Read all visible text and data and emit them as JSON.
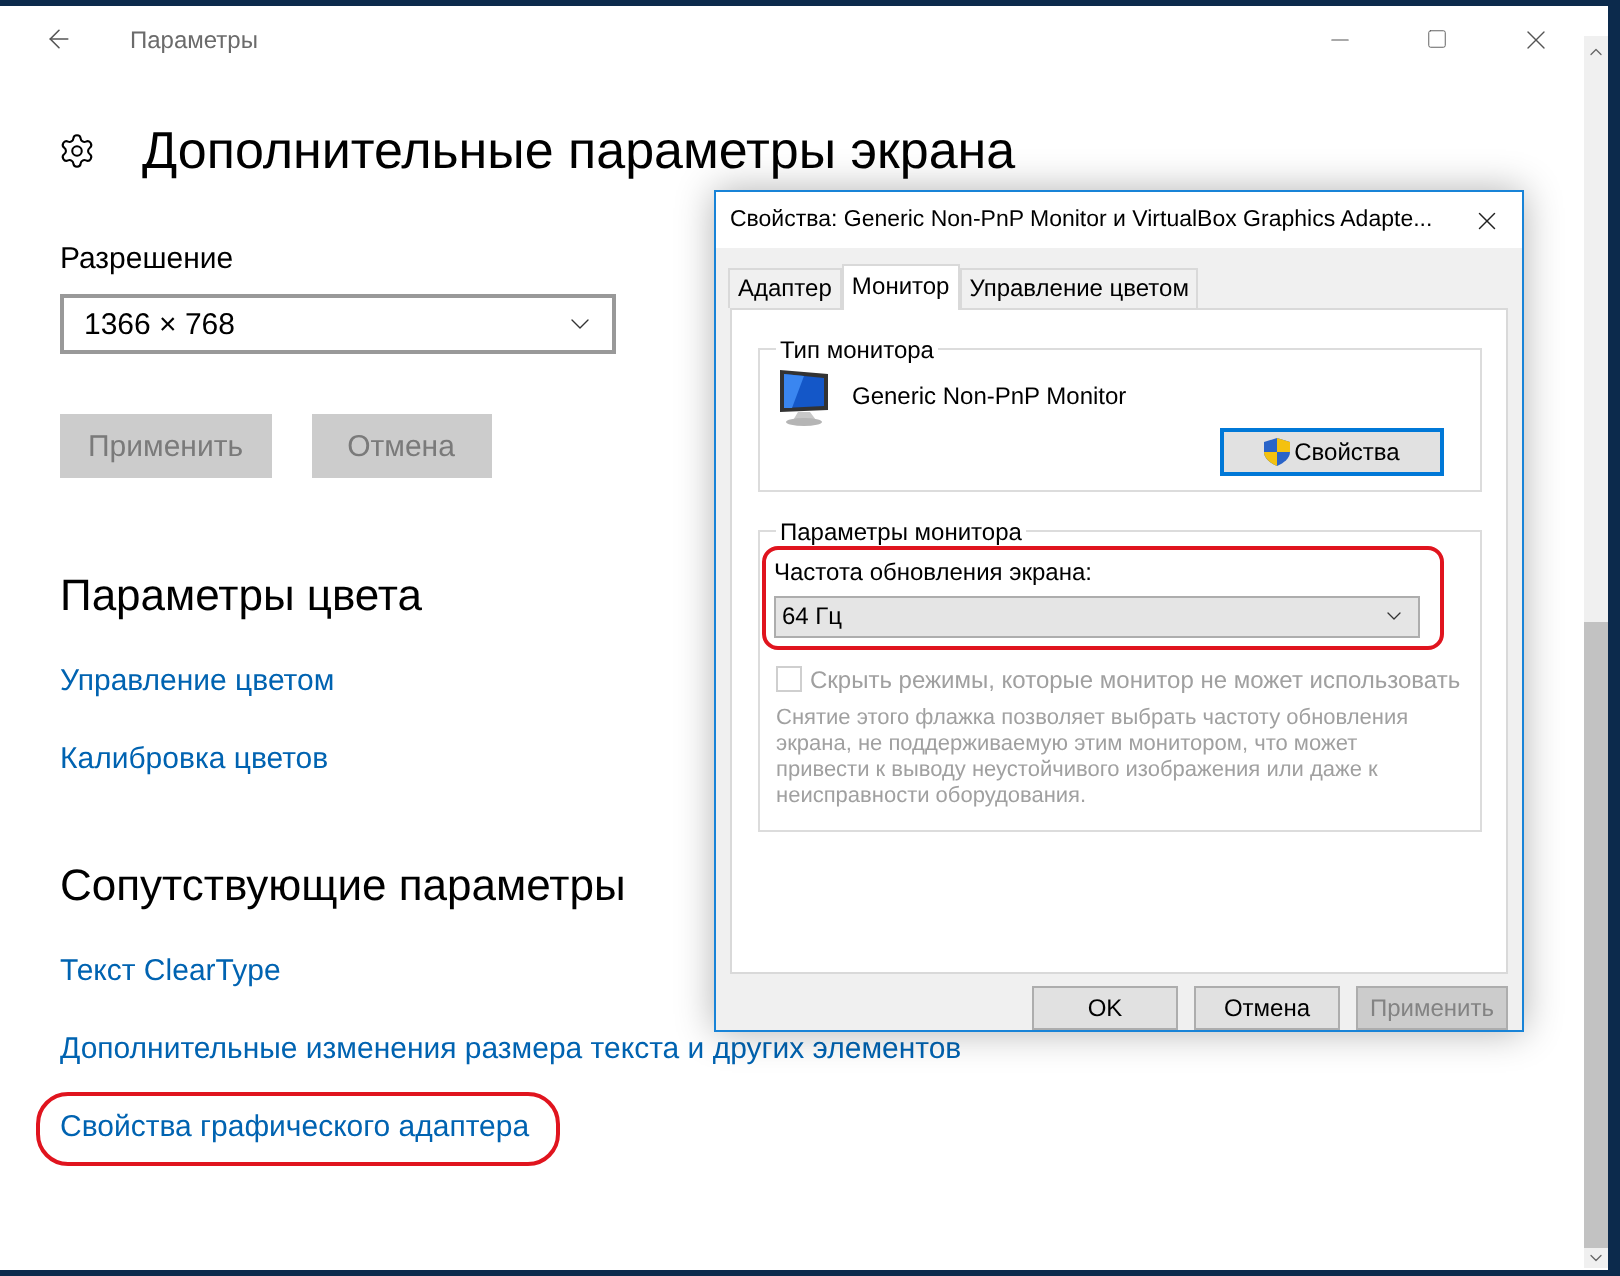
{
  "window": {
    "title": "Параметры"
  },
  "page": {
    "heading": "Дополнительные параметры экрана",
    "resolution": {
      "label": "Разрешение",
      "value": "1366 × 768"
    },
    "buttons": [
      {
        "label": "Применить",
        "disabled": true
      },
      {
        "label": "Отмена",
        "disabled": true
      }
    ],
    "sections": [
      {
        "title": "Параметры цвета",
        "links": [
          {
            "label": "Управление цветом",
            "highlighted": false
          },
          {
            "label": "Калибровка цветов",
            "highlighted": false
          }
        ]
      },
      {
        "title": "Сопутствующие параметры",
        "links": [
          {
            "label": "Текст ClearType",
            "highlighted": false
          },
          {
            "label": "Дополнительные изменения размера текста и других элементов",
            "highlighted": false
          },
          {
            "label": "Свойства графического адаптера",
            "highlighted": true
          }
        ]
      }
    ]
  },
  "dialog": {
    "title": "Свойства: Generic Non-PnP Monitor и VirtualBox Graphics Adapte...",
    "tabs": [
      {
        "label": "Адаптер",
        "selected": false
      },
      {
        "label": "Монитор",
        "selected": true
      },
      {
        "label": "Управление цветом",
        "selected": false
      }
    ],
    "monitor_type": {
      "legend": "Тип монитора",
      "name": "Generic Non-PnP Monitor",
      "button": "Свойства"
    },
    "monitor_settings": {
      "legend": "Параметры монитора",
      "refresh_label": "Частота обновления экрана:",
      "refresh_value": "64 Гц",
      "highlighted": true,
      "hide_modes": {
        "label": "Скрыть режимы, которые монитор не может использовать",
        "checked": false,
        "disabled": true
      },
      "note": "Снятие этого флажка позволяет выбрать частоту обновления экрана, не поддерживаемую этим монитором, что может привести к выводу неустойчивого изображения или даже к неисправности оборудования."
    },
    "buttons": [
      {
        "label": "OK",
        "disabled": false
      },
      {
        "label": "Отмена",
        "disabled": false
      },
      {
        "label": "Применить",
        "disabled": true
      }
    ]
  }
}
